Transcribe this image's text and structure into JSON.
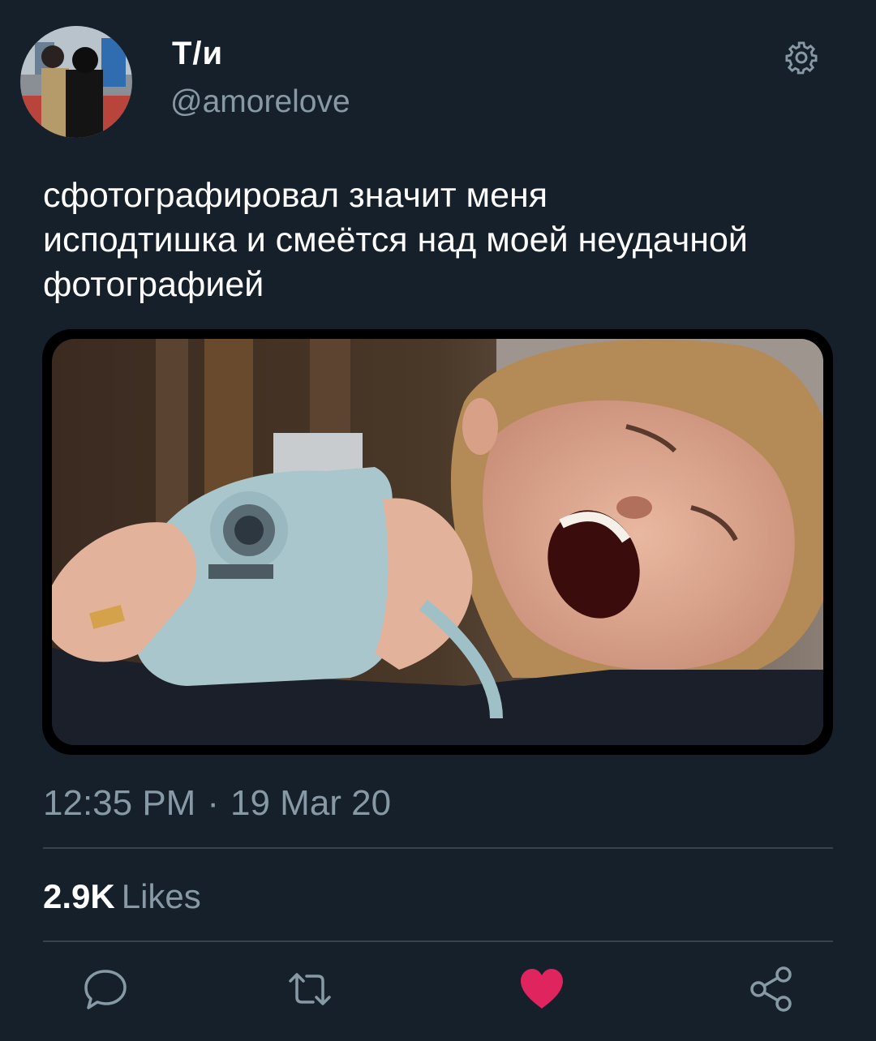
{
  "user": {
    "display_name": "Т/и",
    "handle": "@amorelove"
  },
  "tweet": {
    "text": "сфотографировал значит меня\nисподтишка и смеётся над моей неудачной\nфотографией",
    "time": "12:35 PM",
    "separator": "·",
    "date": "19 Mar 20"
  },
  "stats": {
    "likes_count": "2.9K",
    "likes_label": "Likes"
  },
  "actions": {
    "reply": "reply-icon",
    "retweet": "retweet-icon",
    "like": "heart-icon",
    "share": "share-icon",
    "settings": "gear-icon"
  },
  "colors": {
    "background": "#15202b",
    "secondary_text": "#8899a6",
    "like_red": "#e0245e",
    "divider": "#38444d"
  }
}
